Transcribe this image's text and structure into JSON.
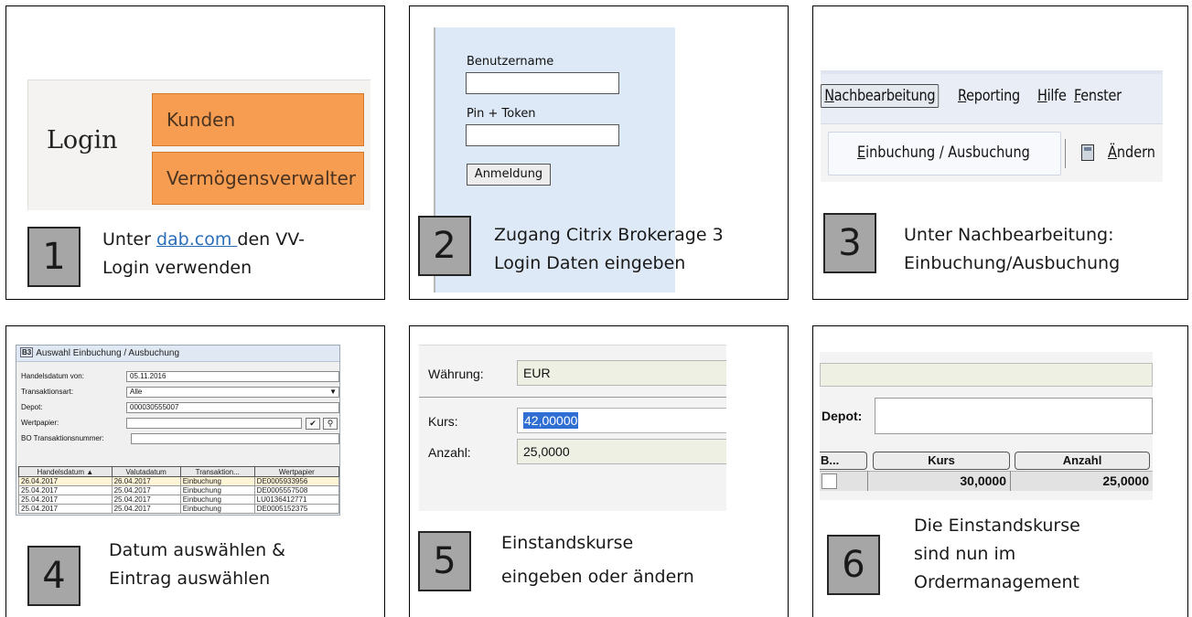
{
  "panels": [
    {
      "number": "1",
      "caption_before_link": "Unter ",
      "caption_link": "dab.com ",
      "caption_after_link": "den VV-",
      "caption_line2": "Login verwenden",
      "screenshot": {
        "login_label": "Login",
        "button_customers": "Kunden",
        "button_asset_manager": "Vermögensverwalter"
      }
    },
    {
      "number": "2",
      "caption_line1": "Zugang Citrix Brokerage 3",
      "caption_line2": "Login Daten eingeben",
      "screenshot": {
        "username_label": "Benutzername",
        "username_value": "",
        "pin_label": "Pin + Token",
        "pin_value": "",
        "login_button": "Anmeldung"
      }
    },
    {
      "number": "3",
      "caption_line1": "Unter Nachbearbeitung:",
      "caption_line2": "Einbuchung/Ausbuchung",
      "screenshot": {
        "menu": [
          {
            "first": "N",
            "rest": "achbearbeitung"
          },
          {
            "first": "R",
            "rest": "eporting"
          },
          {
            "first": "H",
            "rest": "ilfe"
          },
          {
            "first": "F",
            "rest": "enster"
          }
        ],
        "submenu_item_first": "E",
        "submenu_item_rest": "inbuchung / Ausbuchung",
        "edit_first": "Ä",
        "edit_rest": "ndern",
        "edit_icon": "calculator-icon"
      }
    },
    {
      "number": "4",
      "caption_line1": "Datum auswählen &",
      "caption_line2": "Eintrag auswählen",
      "screenshot": {
        "window_icon_text": "B3",
        "window_title": "Auswahl Einbuchung / Ausbuchung",
        "fields": [
          {
            "label": "Handelsdatum von:",
            "value": "05.11.2016"
          },
          {
            "label": "Transaktionsart:",
            "value": "Alle"
          },
          {
            "label": "Depot:",
            "value": "000030555007"
          },
          {
            "label": "Wertpapier:",
            "value": ""
          },
          {
            "label": "BO Transaktionsnummer:",
            "value": ""
          }
        ],
        "table_headers": [
          "Handelsdatum",
          "Valutadatum",
          "Transaktion...",
          "Wertpapier"
        ],
        "rows": [
          [
            "26.04.2017",
            "26.04.2017",
            "Einbuchung",
            "DE0005933956"
          ],
          [
            "25.04.2017",
            "25.04.2017",
            "Einbuchung",
            "DE0005557508"
          ],
          [
            "25.04.2017",
            "25.04.2017",
            "Einbuchung",
            "LU0136412771"
          ],
          [
            "25.04.2017",
            "25.04.2017",
            "Einbuchung",
            "DE0005152375"
          ]
        ]
      }
    },
    {
      "number": "5",
      "caption_line1": "Einstandskurse",
      "caption_line2": "eingeben oder ändern",
      "screenshot": {
        "currency_label": "Währung:",
        "currency_value": "EUR",
        "price_label": "Kurs:",
        "price_value": "42,00000",
        "quantity_label": "Anzahl:",
        "quantity_value": "25,0000"
      }
    },
    {
      "number": "6",
      "caption_line1": "Die Einstandskurse",
      "caption_line2": "sind nun  im",
      "caption_line3": "Ordermanagement",
      "screenshot": {
        "depot_label": "Depot:",
        "column_b": "B...",
        "column_price": "Kurs",
        "column_quantity": "Anzahl",
        "price_value": "30,0000",
        "quantity_value": "25,0000"
      }
    }
  ]
}
